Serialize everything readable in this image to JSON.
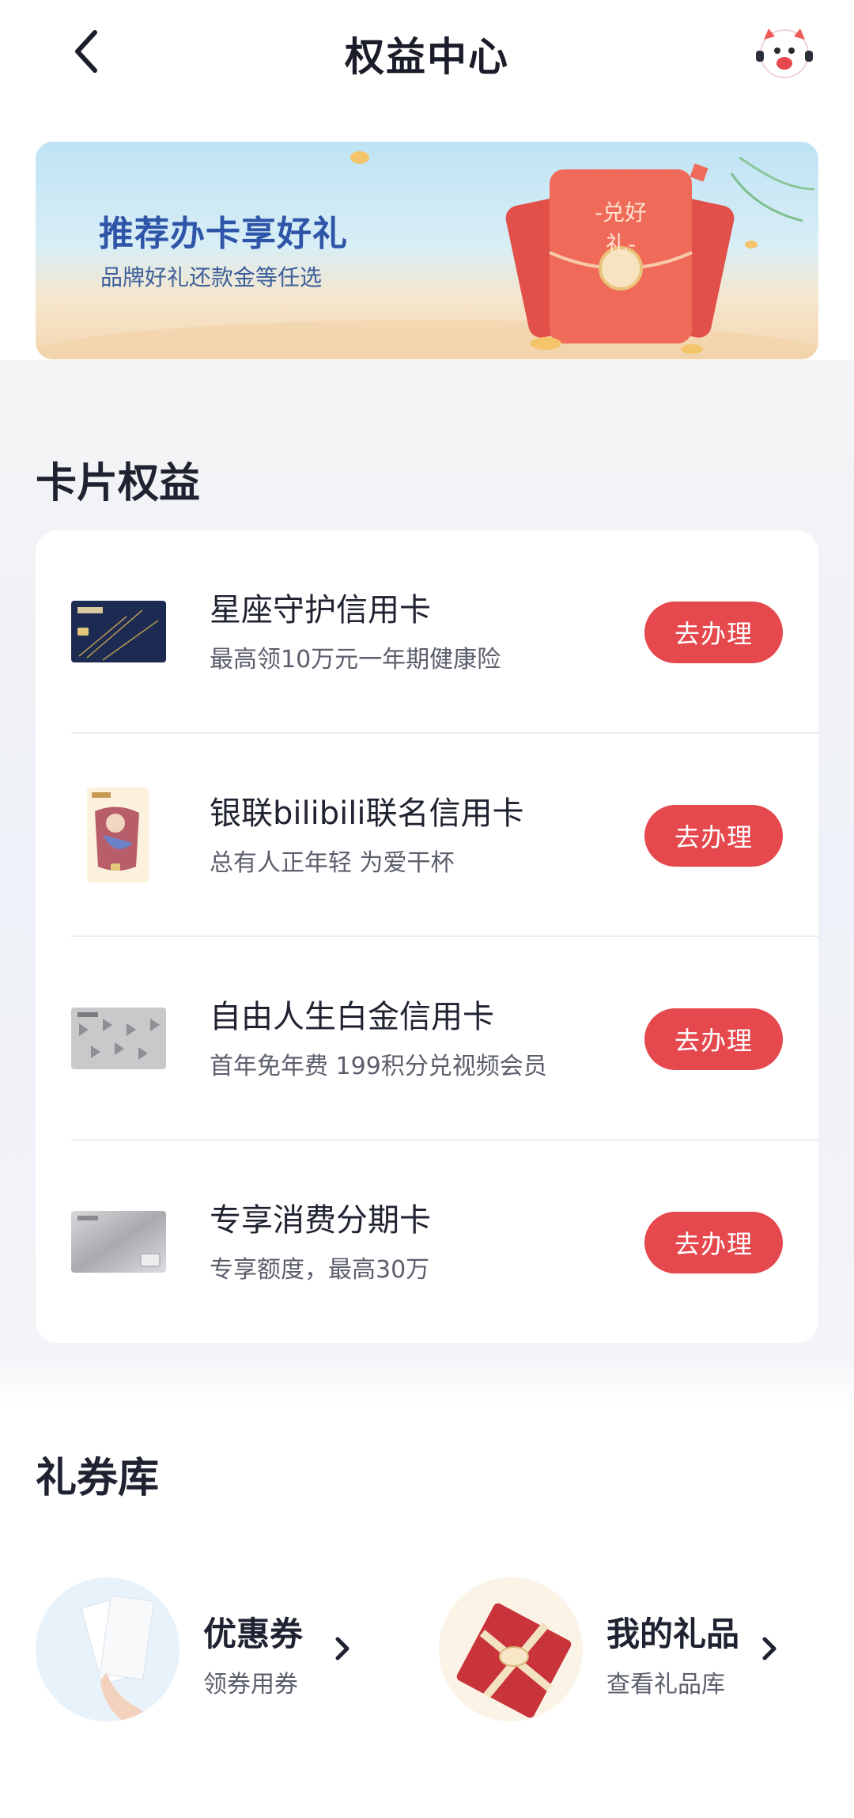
{
  "header": {
    "title": "权益中心",
    "back_icon": "chevron-left-icon",
    "mascot_icon": "mascot-icon"
  },
  "banner": {
    "title": "推荐办卡享好礼",
    "subtitle": "品牌好礼还款金等任选",
    "packet_label": "-兑好礼-"
  },
  "card_section": {
    "title": "卡片权益",
    "cards": [
      {
        "name": "星座守护信用卡",
        "desc": "最高领10万元一年期健康险",
        "button": "去办理"
      },
      {
        "name": "银联bilibili联名信用卡",
        "desc": "总有人正年轻 为爱干杯",
        "button": "去办理"
      },
      {
        "name": "自由人生白金信用卡",
        "desc": "首年免年费 199积分兑视频会员",
        "button": "去办理"
      },
      {
        "name": "专享消费分期卡",
        "desc": "专享额度，最高30万",
        "button": "去办理"
      }
    ]
  },
  "coupon_section": {
    "title": "礼券库",
    "items": [
      {
        "title": "优惠券",
        "subtitle": "领券用券"
      },
      {
        "title": "我的礼品",
        "subtitle": "查看礼品库"
      }
    ]
  },
  "colors": {
    "accent": "#e5484d",
    "banner_title": "#2f55a8",
    "text_primary": "#1f2230",
    "text_secondary": "#5b5e6b"
  }
}
